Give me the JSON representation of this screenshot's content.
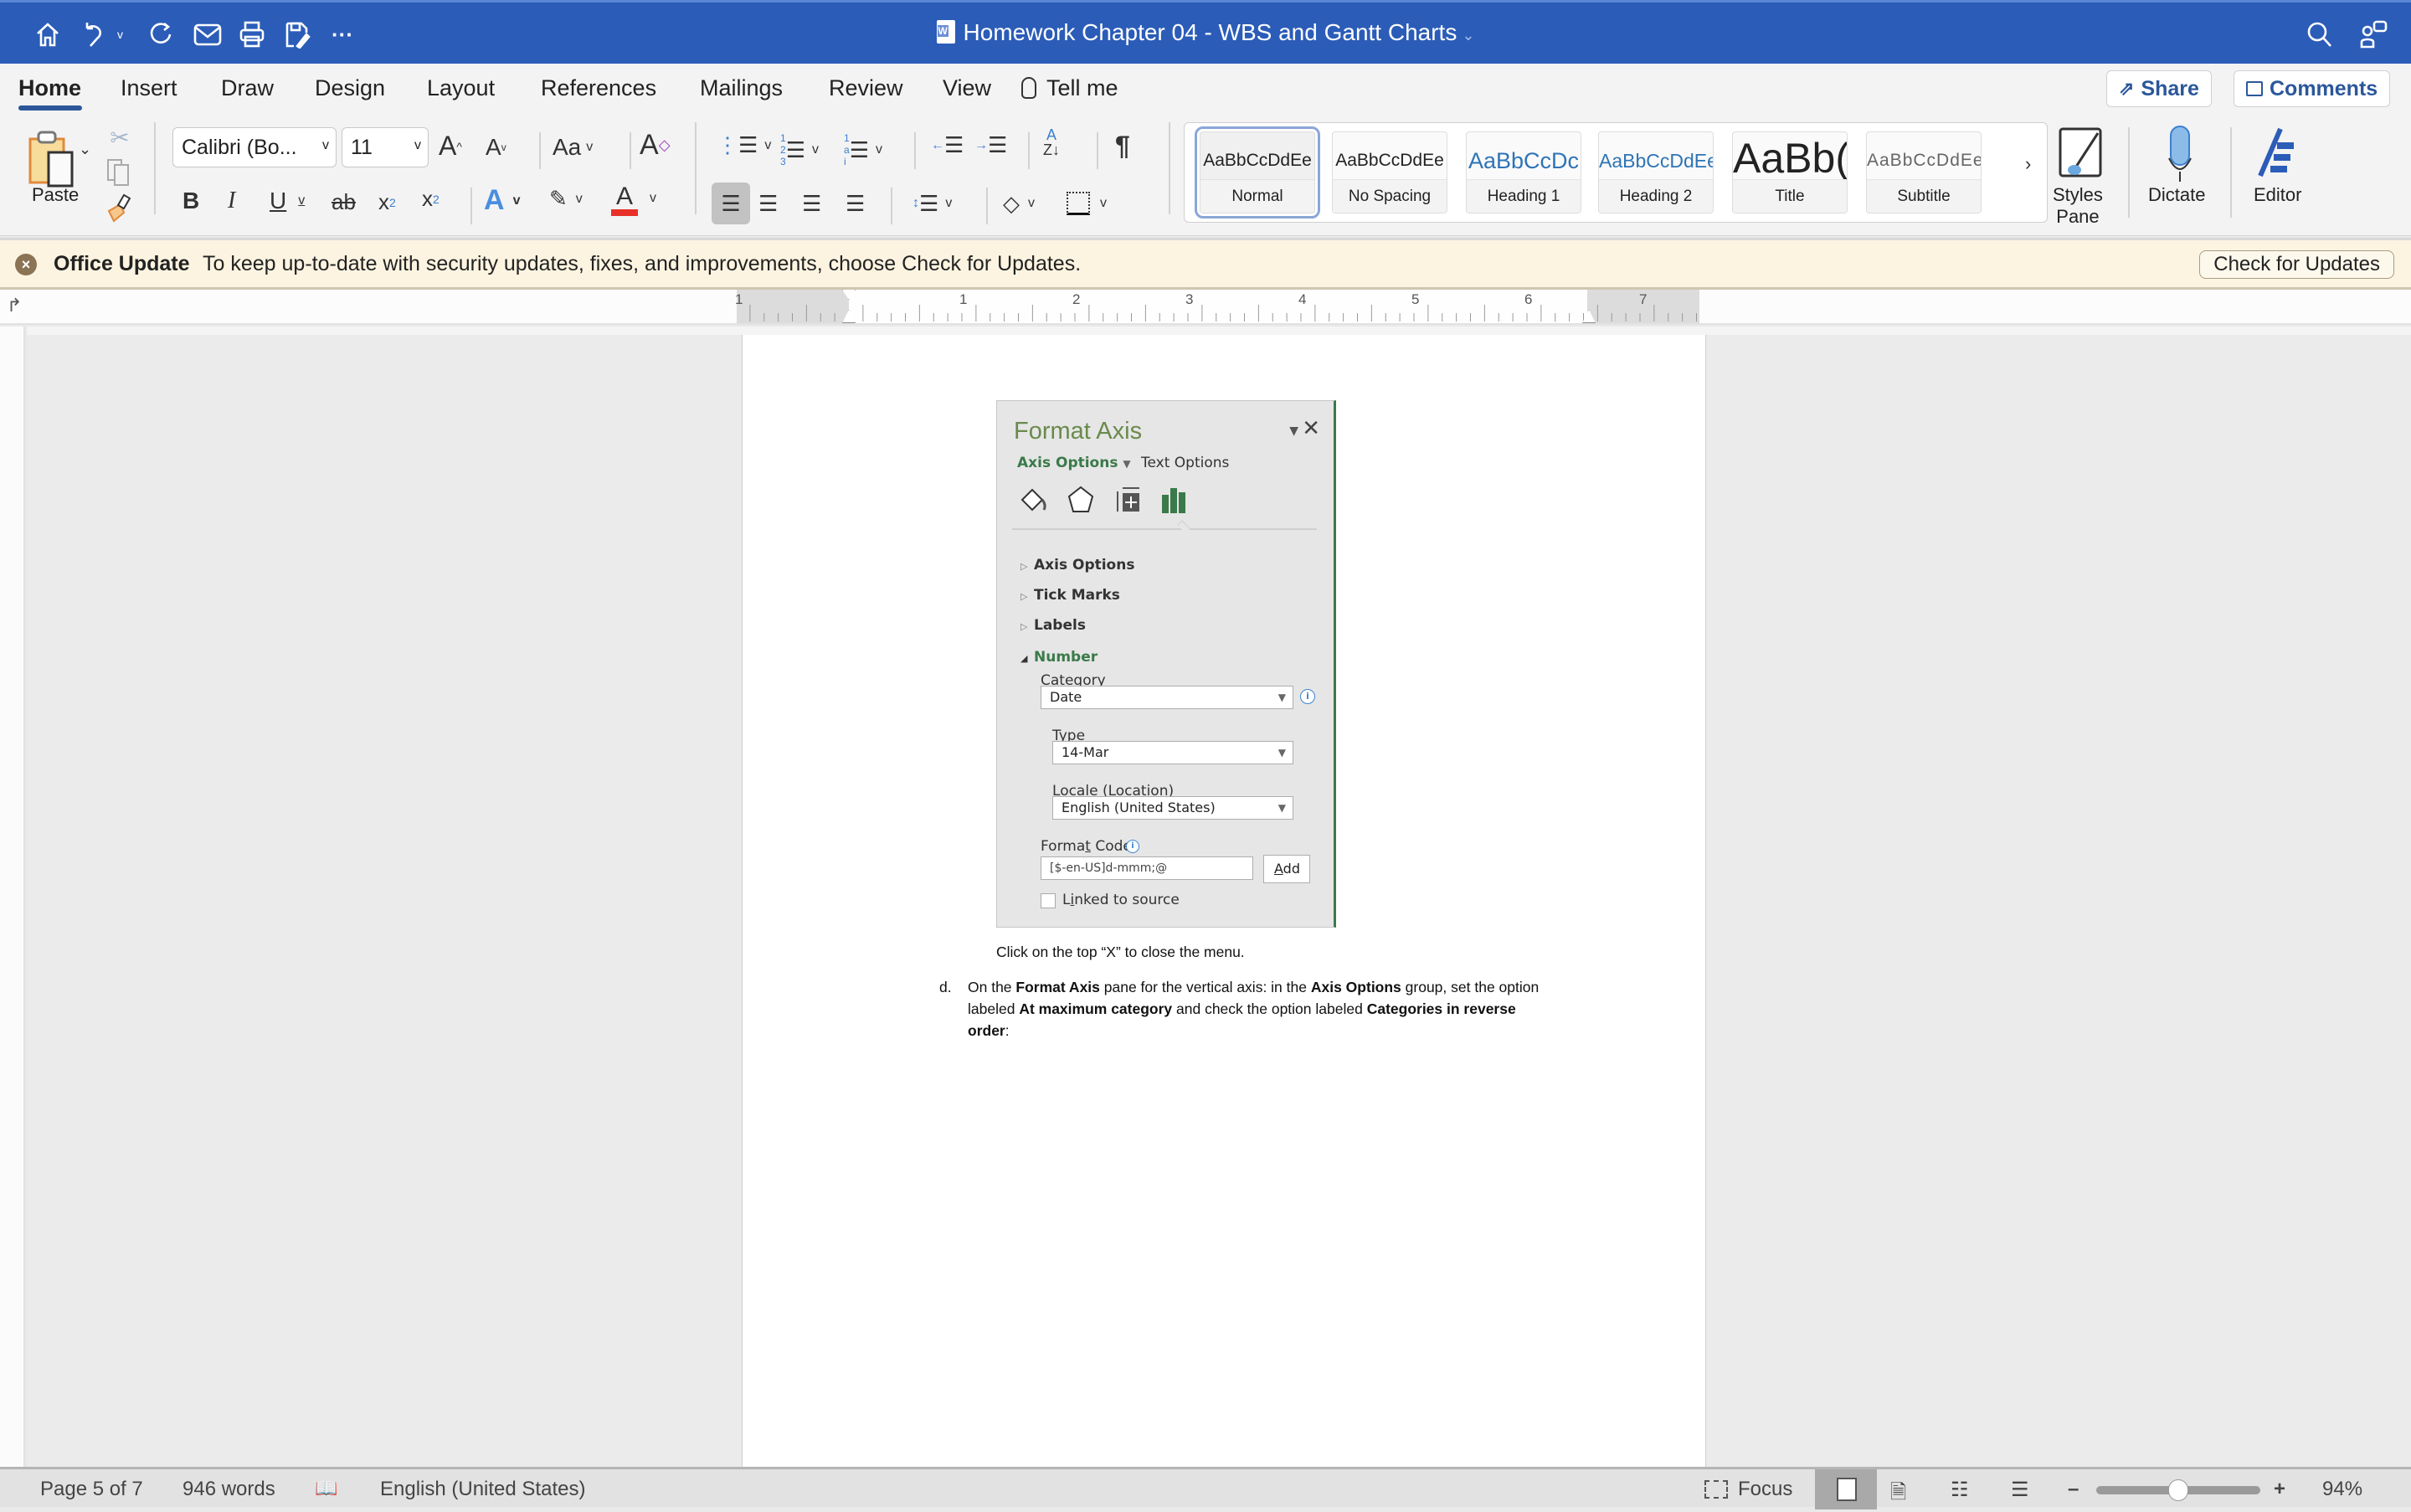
{
  "window": {
    "title": "Homework Chapter 04 - WBS and Gantt Charts",
    "brand_color": "#2b5cb8"
  },
  "quick_access": [
    {
      "icon": "home-icon"
    },
    {
      "icon": "undo-icon"
    },
    {
      "icon": "redo-icon"
    },
    {
      "icon": "email-icon"
    },
    {
      "icon": "print-icon"
    },
    {
      "icon": "save-as-icon"
    },
    {
      "icon": "more-icon",
      "glyph": "···"
    }
  ],
  "tabs": [
    {
      "label": "Home",
      "active": true
    },
    {
      "label": "Insert"
    },
    {
      "label": "Draw"
    },
    {
      "label": "Design"
    },
    {
      "label": "Layout"
    },
    {
      "label": "References"
    },
    {
      "label": "Mailings"
    },
    {
      "label": "Review"
    },
    {
      "label": "View"
    },
    {
      "label": "Tell me"
    }
  ],
  "header_buttons": {
    "share": "Share",
    "comments": "Comments"
  },
  "ribbon": {
    "paste_label": "Paste",
    "font_name": "Calibri (Bo...",
    "font_size": "11",
    "change_case": "Aa",
    "styles": [
      {
        "sample": "AaBbCcDdEe",
        "label": "Normal",
        "selected": true
      },
      {
        "sample": "AaBbCcDdEe",
        "label": "No Spacing"
      },
      {
        "sample": "AaBbCcDc",
        "label": "Heading 1"
      },
      {
        "sample": "AaBbCcDdEe",
        "label": "Heading 2"
      },
      {
        "sample": "AaBb(",
        "label": "Title"
      },
      {
        "sample": "AaBbCcDdEe",
        "label": "Subtitle"
      }
    ],
    "styles_pane": "Styles Pane",
    "styles_pane_l1": "Styles",
    "styles_pane_l2": "Pane",
    "dictate": "Dictate",
    "editor": "Editor",
    "font_color": "#e8312a"
  },
  "update_bar": {
    "title": "Office Update",
    "message": "To keep up-to-date with security updates, fixes, and improvements, choose Check for Updates.",
    "button": "Check for Updates"
  },
  "ruler": {
    "numbers": [
      "1",
      "1",
      "2",
      "3",
      "4",
      "5",
      "6",
      "7"
    ]
  },
  "format_axis_panel": {
    "title": "Format Axis",
    "tab_axis_options": "Axis Options",
    "tab_text_options": "Text Options",
    "accent_color": "#3a7a4a",
    "sections": [
      "Axis Options",
      "Tick Marks",
      "Labels"
    ],
    "expanded_section": "Number",
    "category_label": "Category",
    "category_value": "Date",
    "type_label": "Type",
    "type_value": "14-Mar",
    "locale_label": "Locale (Location)",
    "locale_value": "English (United States)",
    "format_code_label": "Format Code",
    "format_code_value": "[$-en-US]d-mmm;@",
    "add_button": "Add",
    "linked_label": "Linked to source",
    "linked_checked": false
  },
  "document": {
    "caption": "Click on the top “X” to close the menu.",
    "step_marker": "d.",
    "step_parts": {
      "p1": "On the ",
      "b1": "Format Axis",
      "p2": " pane for the vertical axis: in the ",
      "b2": "Axis Options",
      "p3": " group, set the option",
      "p4": "labeled ",
      "b3": "At maximum category",
      "p5": " and check the option labeled ",
      "b4": "Categories in reverse",
      "b5": "order",
      "p6": ":"
    }
  },
  "status_bar": {
    "page": "Page 5 of 7",
    "words": "946 words",
    "language": "English (United States)",
    "focus": "Focus",
    "zoom": "94%",
    "zoom_fraction": 0.5
  }
}
